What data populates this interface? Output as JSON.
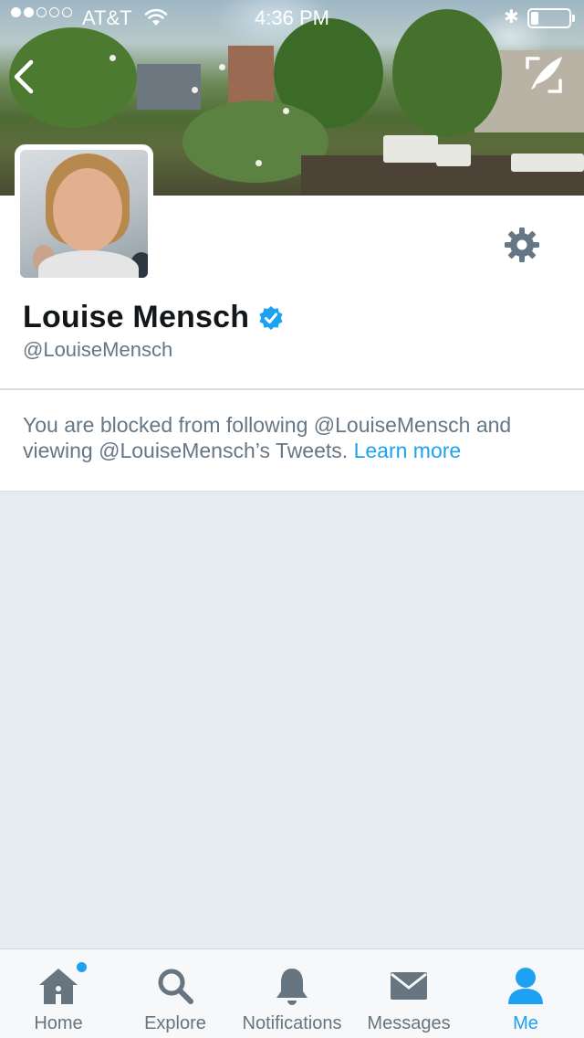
{
  "status_bar": {
    "carrier": "AT&T",
    "time": "4:36 PM",
    "signal_bars_filled": 2,
    "signal_bars_total": 5,
    "battery_level": 0.2
  },
  "profile": {
    "name": "Louise Mensch",
    "handle": "@LouiseMensch",
    "verified": true
  },
  "notice": {
    "text": "You are blocked from following @LouiseMensch and viewing @LouiseMensch’s Tweets.",
    "link": "Learn more"
  },
  "tabbar": {
    "tabs": [
      {
        "label": "Home",
        "icon": "home-icon",
        "has_notification_dot": true
      },
      {
        "label": "Explore",
        "icon": "search-icon"
      },
      {
        "label": "Notifications",
        "icon": "bell-icon"
      },
      {
        "label": "Messages",
        "icon": "envelope-icon"
      },
      {
        "label": "Me",
        "icon": "person-icon",
        "active": true
      }
    ]
  },
  "colors": {
    "accent": "#1da1f2",
    "muted_text": "#657786",
    "tab_icon": "#66757f",
    "background": "#e6ecf0"
  }
}
